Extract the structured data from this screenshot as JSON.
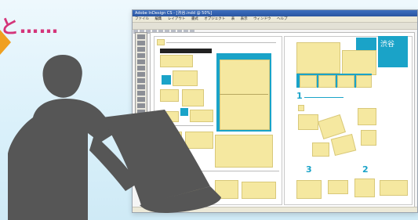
{
  "caption": {
    "text": "と……"
  },
  "window": {
    "title": "Adobe InDesign CS - [渋谷.indd @ 50%]",
    "menu": [
      "ファイル",
      "編集",
      "レイアウト",
      "書式",
      "オブジェクト",
      "表",
      "表示",
      "ウィンドウ",
      "ヘルプ"
    ]
  },
  "page": {
    "badge_text": "渋谷",
    "numbers": [
      "1",
      "2",
      "3"
    ]
  },
  "colors": {
    "accent": "#1aa3c8",
    "highlight": "#f5e8a0",
    "silhouette": "#555555",
    "caption": "#d4357a"
  }
}
